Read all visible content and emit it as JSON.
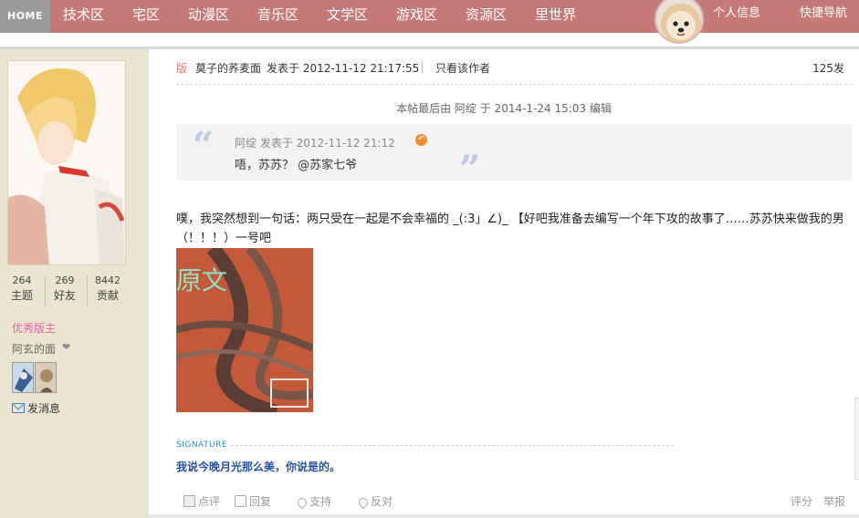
{
  "topnav": {
    "home": "HOME",
    "items": [
      "技术区",
      "宅区",
      "动漫区",
      "音乐区",
      "文学区",
      "游戏区",
      "资源区",
      "里世界"
    ],
    "profile": "个人信息",
    "quick_nav": "快捷导航"
  },
  "author": {
    "stats": [
      {
        "num": "264",
        "label": "主题"
      },
      {
        "num": "269",
        "label": "好友"
      },
      {
        "num": "8442",
        "label": "贡献"
      }
    ],
    "role": "优秀版主",
    "medal_text": "阿玄的面",
    "send_message": "发消息"
  },
  "post": {
    "ban": "版",
    "author_name": "莫子的荞麦面",
    "time": "发表于 2012-11-12 21:17:55",
    "only_author": "只看该作者",
    "floor": "125发",
    "edit_note": "本帖最后由 阿绽 于 2014-1-24 15:03 编辑",
    "quote": {
      "author": "阿绽 发表于 2012-11-12 21:12",
      "text": "唔，苏苏？ @苏家七爷"
    },
    "body": "噗，我突然想到一句话：两只受在一起是不会幸福的 _(:3」∠)_   【好吧我准备去编写一个年下攻的故事了……苏苏快来做我的男（！！！）一号吧",
    "image_caption": "原文",
    "signature_label": "SIGNATURE",
    "signature": "我说今晚月光那么美，你说是的。"
  },
  "actions": {
    "comment": "点评",
    "reply": "回复",
    "support": "支持",
    "oppose": "反对",
    "rate": "评分",
    "report": "举报"
  },
  "colors": {
    "nav_bg": "#c57a78",
    "sidebar_bg": "#e9e5d0",
    "role": "#e05fa8",
    "signature": "#2a52a3"
  }
}
